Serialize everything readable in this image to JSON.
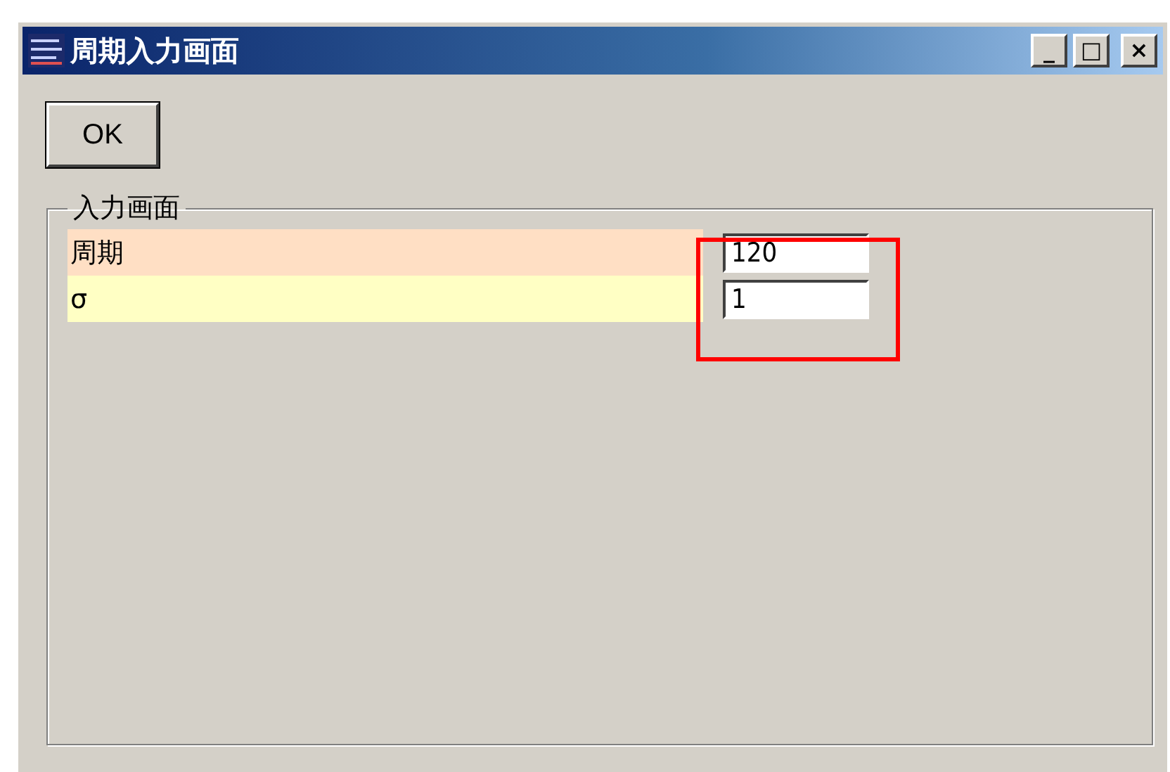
{
  "window": {
    "title": "周期入力画面",
    "controls": [
      {
        "kind": "minimize",
        "label": "_"
      },
      {
        "kind": "maximize",
        "label": "□"
      },
      {
        "kind": "close",
        "label": "×"
      }
    ]
  },
  "ok_button": {
    "label": "OK"
  },
  "group": {
    "title": "入力画面",
    "rows": [
      {
        "label": "周期",
        "value": "120",
        "color": "#ffdfc4"
      },
      {
        "label": "σ",
        "value": "1",
        "color": "#ffffc4"
      }
    ]
  },
  "highlight": {
    "shown": true
  }
}
